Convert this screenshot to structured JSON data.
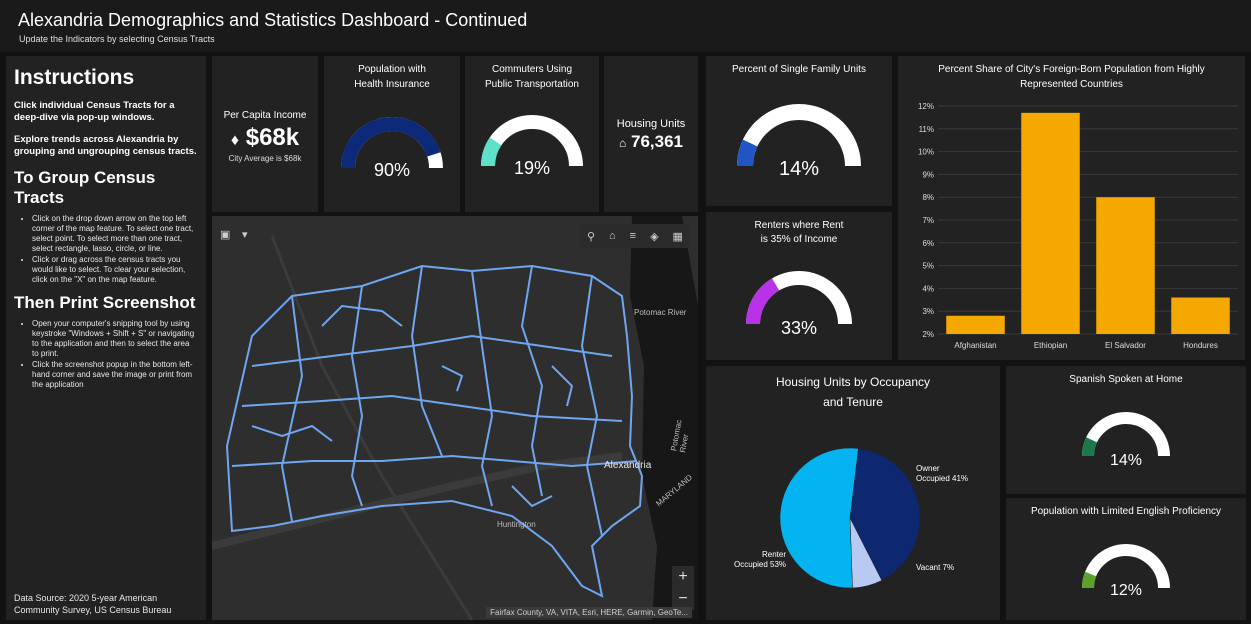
{
  "header": {
    "title": "Alexandria Demographics and Statistics Dashboard - Continued",
    "subtitle": "Update the Indicators by selecting Census Tracts"
  },
  "instructions": {
    "heading": "Instructions",
    "p1": "Click individual Census Tracts for a deep-dive via pop-up windows.",
    "p2": "Explore trends across Alexandria by grouping and ungrouping census tracts.",
    "group_heading": "To Group Census Tracts",
    "group_items": [
      "Click on the drop down arrow on the top left corner of the map feature. To select one tract, select point. To select more than one tract, select rectangle, lasso, circle, or line.",
      "Click or drag across the census tracts you would like to select. To clear your selection, click on the \"X\" on the map feature."
    ],
    "print_heading": "Then Print Screenshot",
    "print_items": [
      "Open your computer's snipping tool by using keystroke \"Windows + Shift + S\" or navigating to the application and then to select the area to print.",
      "Click the screenshot popup in the bottom left-hand corner and save the image or print from the application"
    ],
    "source": "Data Source: 2020 5-year American Community Survey, US Census Bureau"
  },
  "per_capita": {
    "label": "Per Capita Income",
    "value": "$68k",
    "foot": "City Average is $68k"
  },
  "health": {
    "title": "Population with Health Insurance",
    "value": "90%",
    "level": 0.9,
    "color": "#0d2a7a"
  },
  "commuters": {
    "title": "Commuters Using Public Transportation",
    "value": "19%",
    "level": 0.19,
    "color": "#5fe0c8"
  },
  "housing_units": {
    "label": "Housing Units",
    "value": "76,361"
  },
  "single_family": {
    "title": "Percent of Single Family Units",
    "value": "14%",
    "level": 0.14,
    "color": "#2255c4"
  },
  "renters": {
    "title_l1": "Renters where Rent",
    "title_l2": "is 35% of Income",
    "value": "33%",
    "level": 0.33,
    "color": "#b832e8"
  },
  "spanish": {
    "title": "Spanish Spoken at Home",
    "value": "14%",
    "level": 0.14,
    "color": "#1a7a4a"
  },
  "lep": {
    "title": "Population with Limited English Proficiency",
    "value": "12%",
    "level": 0.12,
    "color": "#5ea12a"
  },
  "map": {
    "labels": {
      "potomac": "Potomac River",
      "alexandria": "Alexandria",
      "huntington": "Huntington",
      "maryland": "MARYLAND",
      "potomac2": "Potomac River"
    },
    "attribution": "Fairfax County, VA, VITA, Esri, HERE, Garmin, GeoTe...",
    "zoom_in": "+",
    "zoom_out": "−"
  },
  "chart_data": [
    {
      "type": "bar",
      "title": "Percent Share of City's Foreign-Born Population from Highly Represented Countries",
      "categories": [
        "Afghanistan",
        "Ethiopian",
        "El Salvador",
        "Hondures"
      ],
      "values": [
        2.8,
        11.7,
        8.0,
        3.6
      ],
      "ylim": [
        2,
        12
      ],
      "yticks": [
        "2%",
        "3%",
        "4%",
        "5%",
        "6%",
        "7%",
        "8%",
        "9%",
        "10%",
        "11%",
        "12%"
      ],
      "color": "#f5a800"
    },
    {
      "type": "pie",
      "title": "Housing Units by Occupancy and Tenure",
      "slices": [
        {
          "name": "Owner Occupied",
          "label_l1": "Owner",
          "label_l2": "Occupied 41%",
          "value": 41,
          "color": "#0d2770"
        },
        {
          "name": "Vacant",
          "label_l1": "Vacant 7%",
          "label_l2": "",
          "value": 7,
          "color": "#b8c9f2"
        },
        {
          "name": "Renter Occupied",
          "label_l1": "Renter",
          "label_l2": "Occupied 53%",
          "value": 53,
          "color": "#04b4f0"
        }
      ]
    }
  ]
}
